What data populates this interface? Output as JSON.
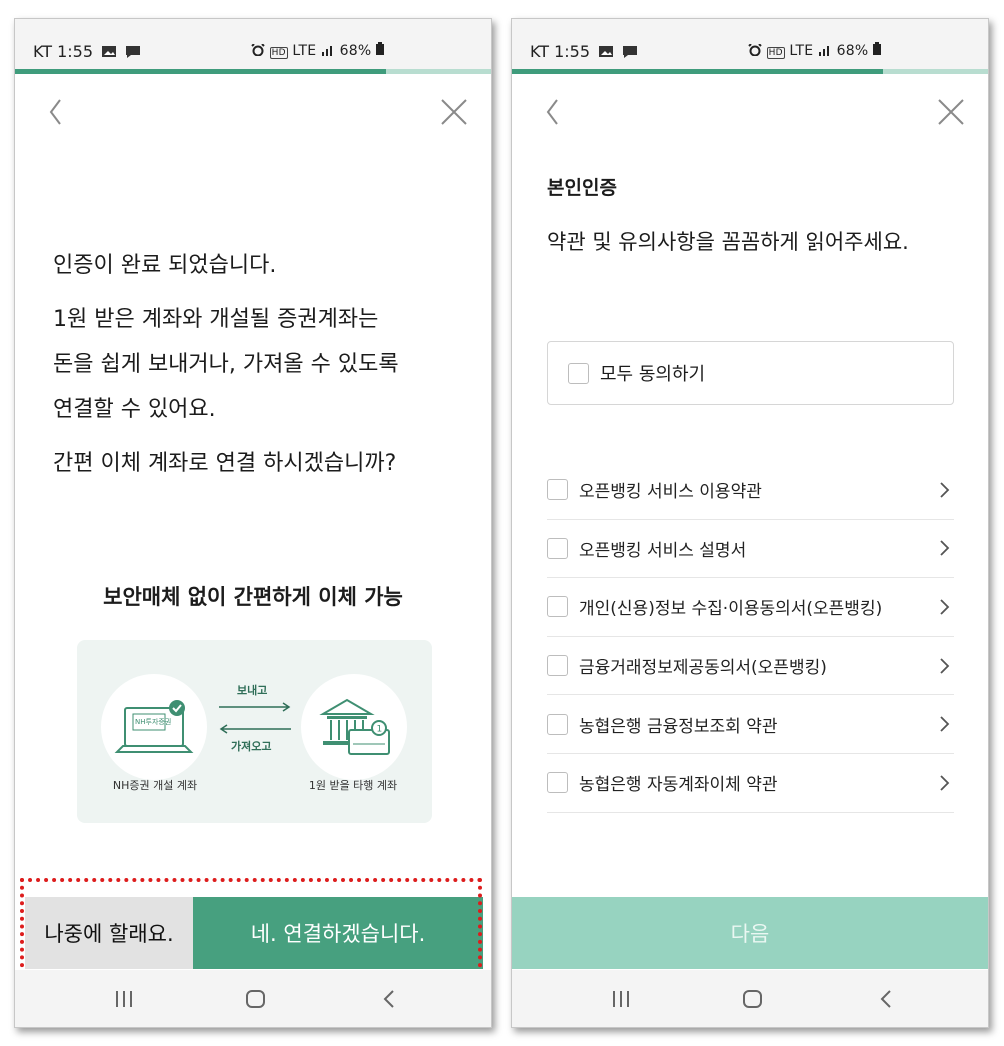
{
  "status_bar": {
    "carrier_time": "KT 1:55",
    "network": "LTE",
    "battery": "68%"
  },
  "left_screen": {
    "message_line1": "인증이 완료 되었습니다.",
    "message_line2": "1원 받은 계좌와 개설될 증권계좌는",
    "message_line3": "돈을 쉽게 보내거나, 가져올 수 있도록",
    "message_line4": "연결할 수 있어요.",
    "question": "간편 이체 계좌로 연결 하시겠습니까?",
    "subhead": "보안매체 없이 간편하게 이체 가능",
    "illustration": {
      "send_label": "보내고",
      "receive_label": "가져오고",
      "laptop_label": "NH투자증권",
      "left_caption": "NH증권 개설 계좌",
      "right_caption": "1원 받을 타행 계좌"
    },
    "later_button": "나중에 할래요.",
    "connect_button": "네. 연결하겠습니다."
  },
  "right_screen": {
    "title": "본인인증",
    "subtitle": "약관 및 유의사항을 꼼꼼하게 읽어주세요.",
    "agree_all": "모두 동의하기",
    "terms": [
      "오픈뱅킹 서비스 이용약관",
      "오픈뱅킹 서비스 설명서",
      "개인(신용)정보 수집·이용동의서(오픈뱅킹)",
      "금융거래정보제공동의서(오픈뱅킹)",
      "농협은행  금융정보조회 약관",
      "농협은행  자동계좌이체 약관"
    ],
    "next_button": "다음"
  },
  "colors": {
    "accent": "#47a07f",
    "accent_light": "#97d3c0",
    "highlight_frame": "#dd1d1d"
  },
  "icons": [
    "back-icon",
    "close-icon",
    "chevron-right-icon",
    "recents-icon",
    "home-icon",
    "nav-back-icon"
  ]
}
